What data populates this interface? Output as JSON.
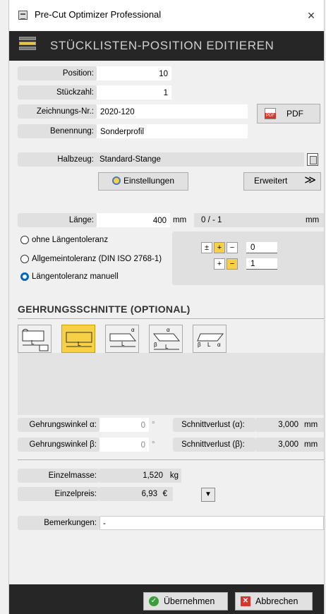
{
  "window": {
    "title": "Pre-Cut Optimizer Professional",
    "close": "×"
  },
  "header": {
    "title": "STÜCKLISTEN-POSITION EDITIEREN"
  },
  "fields": {
    "position_label": "Position:",
    "position_value": "10",
    "count_label": "Stückzahl:",
    "count_value": "1",
    "drawing_label": "Zeichnungs-Nr.:",
    "drawing_value": "2020-120",
    "name_label": "Benennung:",
    "name_value": "Sonderprofil",
    "stock_label": "Halbzeug:",
    "stock_value": "Standard-Stange"
  },
  "buttons": {
    "pdf": "PDF",
    "settings": "Einstellungen",
    "advanced": "Erweitert",
    "advanced_arrow": "≫",
    "ok": "Übernehmen",
    "cancel": "Abbrechen"
  },
  "length": {
    "label": "Länge:",
    "value": "400",
    "unit": "mm",
    "tolerance": "0 / - 1",
    "tolerance_unit": "mm"
  },
  "tolerance_options": [
    {
      "label": "ohne Längentoleranz",
      "selected": false
    },
    {
      "label": "Allgemeintoleranz (DIN ISO 2768-1)",
      "selected": false
    },
    {
      "label": "Längentoleranz manuell",
      "selected": true
    }
  ],
  "tolerance_panel": {
    "pm": "±",
    "plus": "+",
    "minus": "−",
    "row1_value": "0",
    "row2_value": "1"
  },
  "miter": {
    "section_title": "GEHRUNGSSCHNITTE (OPTIONAL)",
    "options": [
      "straight-list",
      "straight",
      "alpha",
      "alpha-beta",
      "beta-alpha"
    ],
    "selected": 1,
    "alpha_label": "Gehrungswinkel α:",
    "alpha_value": "0",
    "alpha_unit": "°",
    "beta_label": "Gehrungswinkel β:",
    "beta_value": "0",
    "beta_unit": "°",
    "loss_alpha_label": "Schnittverlust (α):",
    "loss_alpha_value": "3,000",
    "loss_alpha_unit": "mm",
    "loss_beta_label": "Schnittverlust (β):",
    "loss_beta_value": "3,000",
    "loss_beta_unit": "mm"
  },
  "mass": {
    "label": "Einzelmasse:",
    "value": "1,520",
    "unit": "kg"
  },
  "price": {
    "label": "Einzelpreis:",
    "value": "6,93",
    "unit": "€"
  },
  "remarks": {
    "label": "Bemerkungen:",
    "value": "-"
  },
  "icons": {
    "dropdown": "▼",
    "ok": "✓",
    "cancel": "✕"
  },
  "colors": {
    "accent_yellow": "#f7d046",
    "dark_bar": "#262626",
    "radio_blue": "#0067c0"
  }
}
